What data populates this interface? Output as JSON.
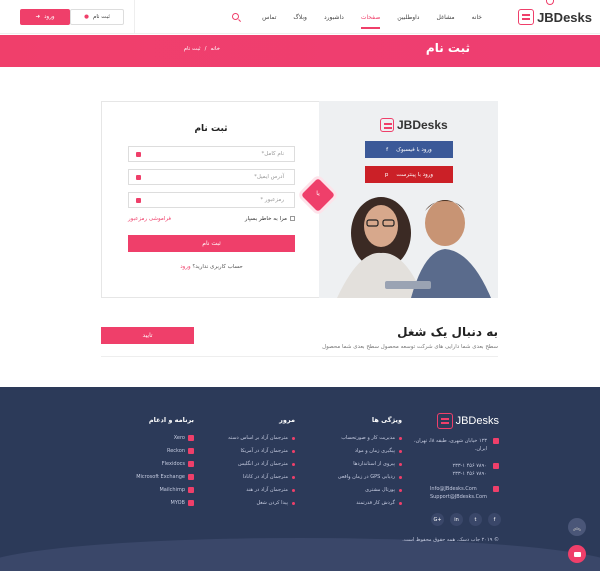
{
  "brand": {
    "name": "JBDesks",
    "accent": "#ef3f6a",
    "footer_bg": "#2c3a59"
  },
  "header": {
    "nav": [
      "خانه",
      "مشاغل",
      "داوطلبین",
      "صفحات",
      "داشبورد",
      "وبلاگ",
      "تماس"
    ],
    "active_nav": "صفحات",
    "signup_label": "ثبت نام",
    "login_label": "ورود"
  },
  "banner": {
    "title": "ثبت نام",
    "breadcrumb_home": "خانه",
    "breadcrumb_sep": "/",
    "breadcrumb_current": "ثبت نام"
  },
  "register": {
    "facebook_label": "ورود با فیسبوک",
    "pinterest_label": "ورود با پینترست",
    "or_label": "یا",
    "title": "ثبت نام",
    "name_placeholder": "نام کامل*",
    "email_placeholder": "آدرس ایمیل*",
    "password_placeholder": "رمزعبور *",
    "remember_label": "مرا به خاطر بسپار",
    "forgot_label": "فراموشی رمزعبور",
    "submit_label": "ثبت نام",
    "no_account_text": "حساب کاربری ندارید؟",
    "login_link": "ورود"
  },
  "job": {
    "title": "به دنبال یک شغل",
    "subtitle": "سطح بعدی شما دارایی های شرکت توسعه محصول سطح بعدی شما محصول",
    "button_label": "تایید"
  },
  "footer": {
    "address": "۱۲۳ خیابان شهری، طبقه ۸ا، تهران، ایران.",
    "phone1": "۷۸۹۰ ۴۵۶ ۲۳۳-۱",
    "phone2": "۷۸۹۰ ۴۵۶ ۲۳۳-۱",
    "email1": "Info@JBdesks.Com",
    "email2": "Support@JBdesks.Com",
    "features_title": "ویژگی ها",
    "features": [
      "مدیریت کار و صورتحساب",
      "پیگیری زمان و مواد",
      "پیروی از استانداردها",
      "ردیابی GPS در زمان واقعی",
      "پورتال مشتری",
      "گردش کار قدرتمند"
    ],
    "browse_title": "مرور",
    "browse": [
      "مترجمان آزاد بر اساس دسته",
      "مترجمان آزاد در آمریکا",
      "مترجمان آزاد در انگلیس",
      "مترجمان آزاد در کانادا",
      "مترجمان آزاد در هند",
      "پیدا کردن شغل"
    ],
    "apps_title": "برنامه و ادغام",
    "apps": [
      "Xero",
      "Reckon",
      "Flexidocs",
      "Microsoft Exchange",
      "Mailchimp",
      "MYOB"
    ],
    "social": [
      "f",
      "t",
      "in",
      "G+"
    ],
    "copyright": "© ۲۰۱۹ جاب دسک. همه حقوق محفوظ است."
  }
}
